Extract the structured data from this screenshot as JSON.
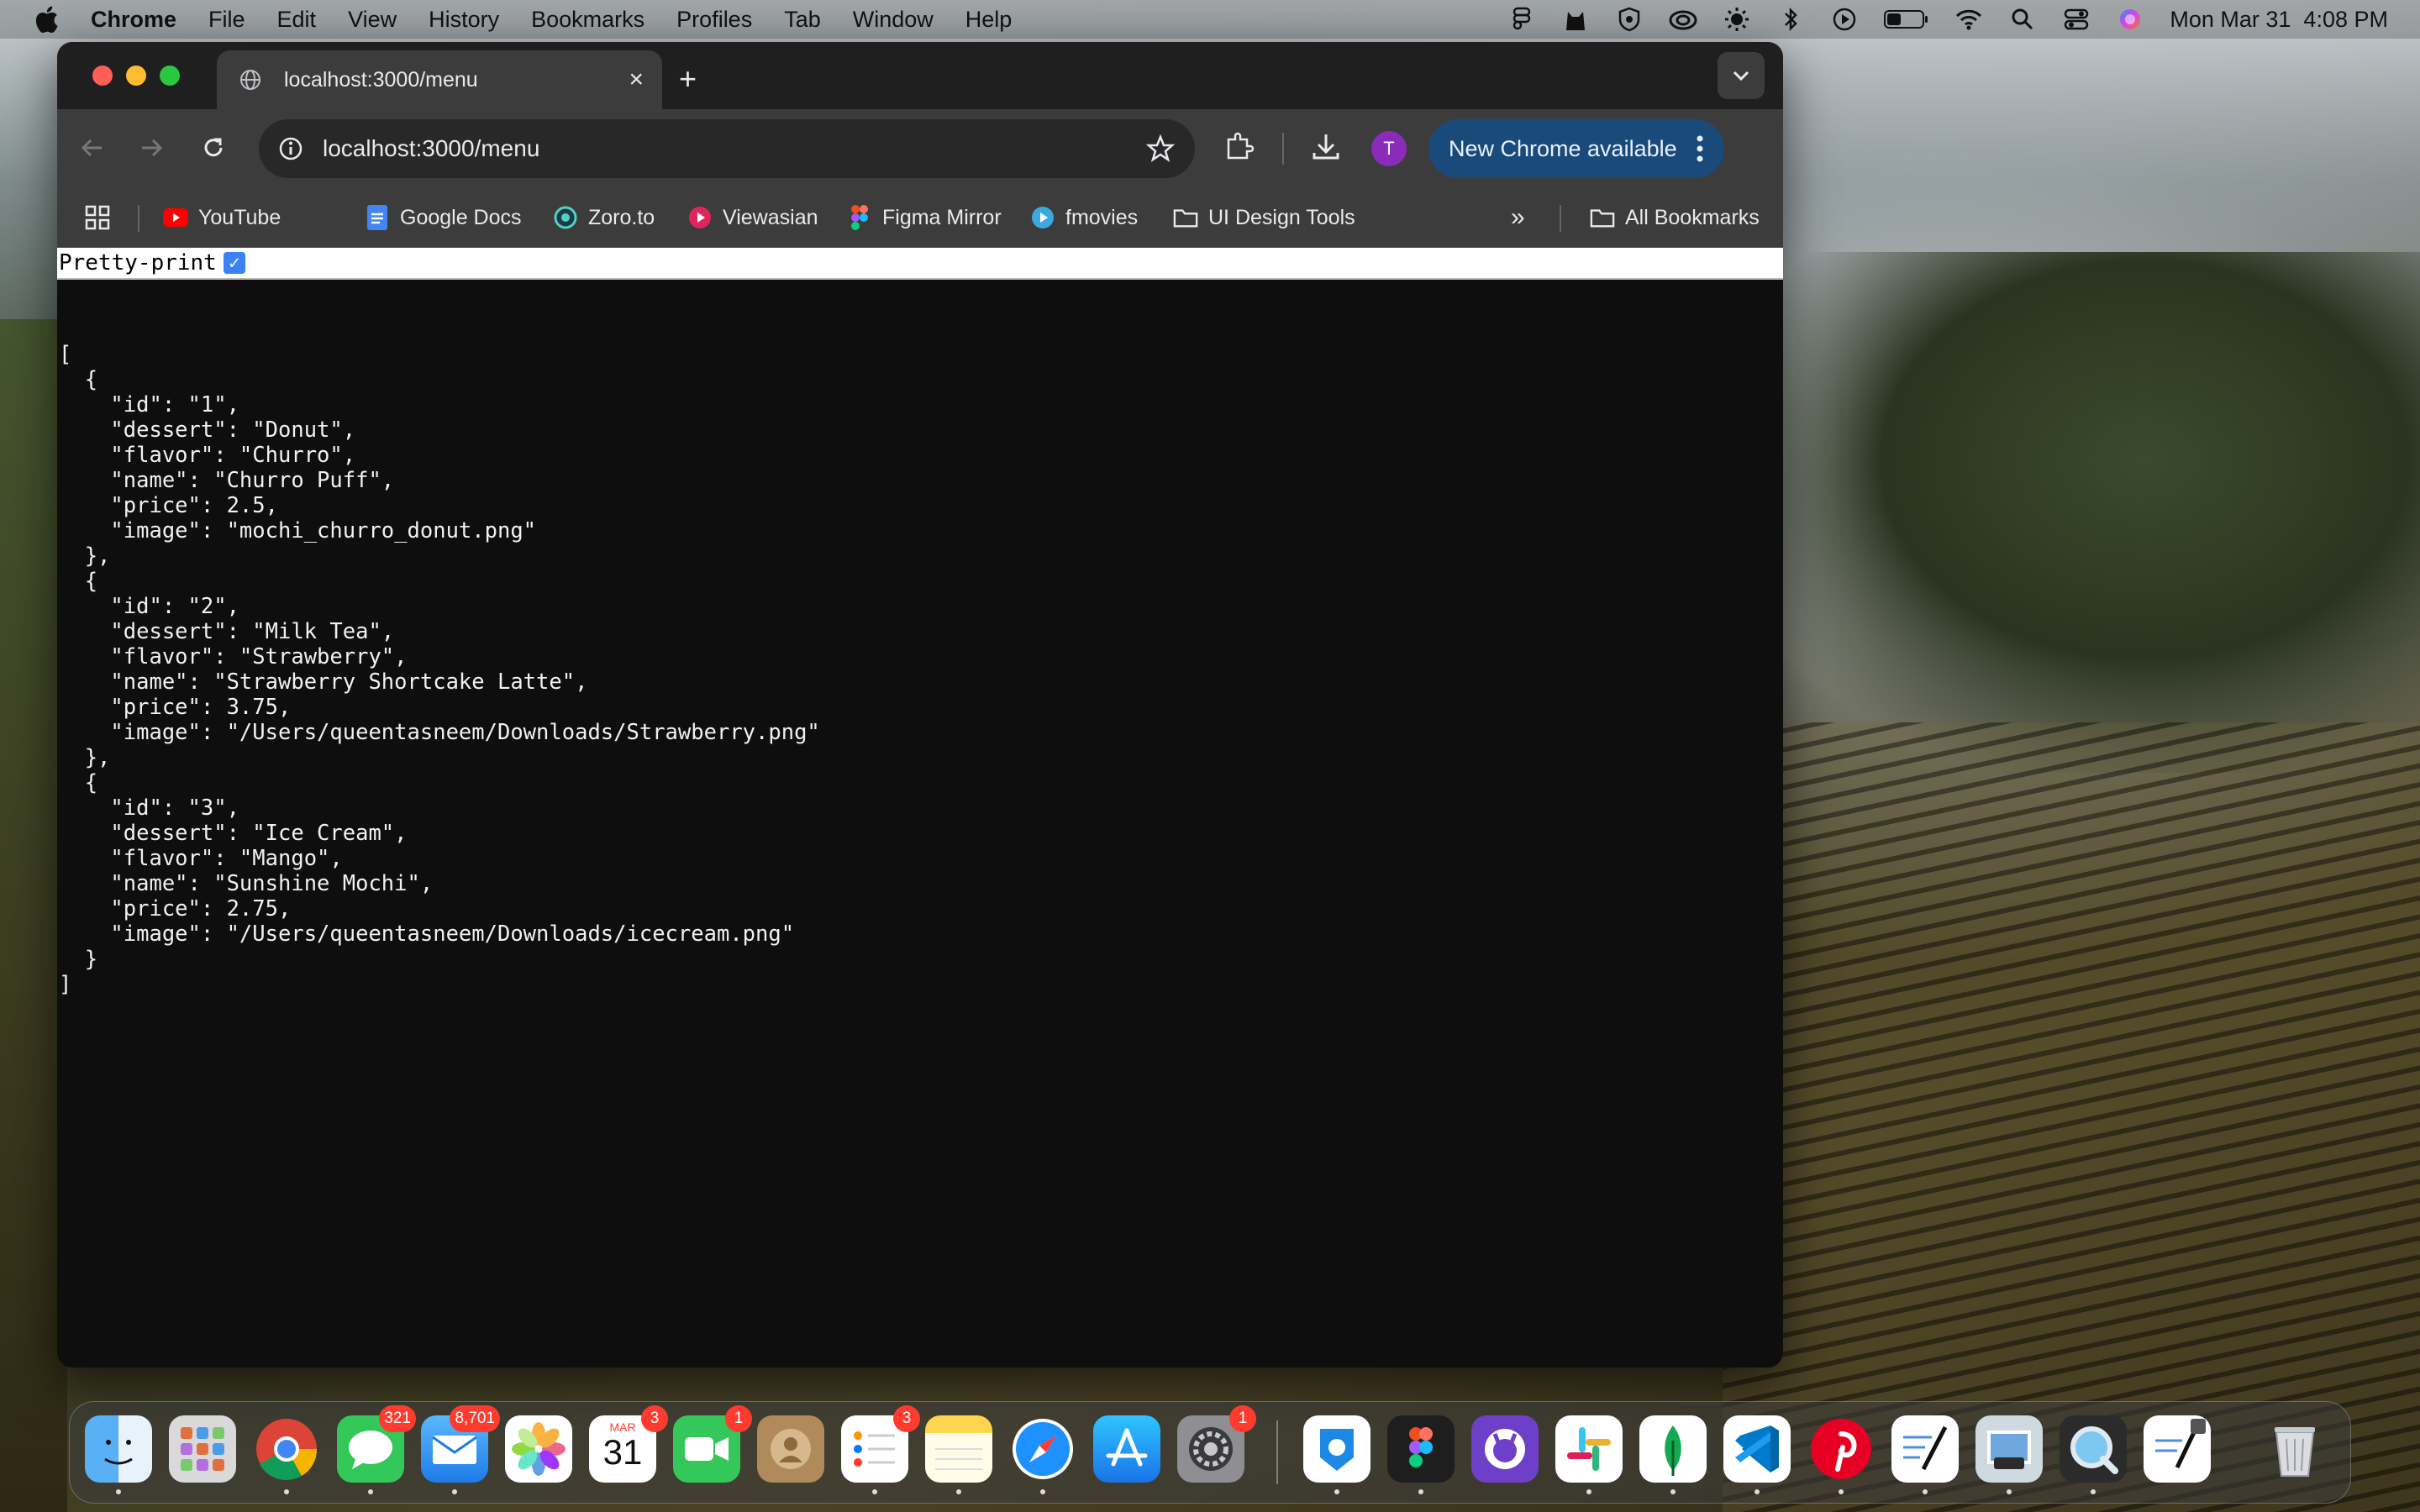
{
  "menubar": {
    "app": "Chrome",
    "items": [
      "File",
      "Edit",
      "View",
      "History",
      "Bookmarks",
      "Profiles",
      "Tab",
      "Window",
      "Help"
    ],
    "datetime": "Mon Mar 31  4:08 PM"
  },
  "tab": {
    "title": "localhost:3000/menu",
    "close": "×",
    "new_tab": "+"
  },
  "toolbar": {
    "url": "localhost:3000/menu",
    "avatar_initial": "T",
    "update_label": "New Chrome available"
  },
  "bookmarks": {
    "items": [
      "YouTube",
      "Google Docs",
      "Zoro.to",
      "Viewasian",
      "Figma Mirror",
      "fmovies",
      "UI Design Tools"
    ],
    "overflow": "»",
    "all": "All Bookmarks"
  },
  "pretty_print": {
    "label": "Pretty-print",
    "checked": "✓"
  },
  "json_text": "[\n  {\n    \"id\": \"1\",\n    \"dessert\": \"Donut\",\n    \"flavor\": \"Churro\",\n    \"name\": \"Churro Puff\",\n    \"price\": 2.5,\n    \"image\": \"mochi_churro_donut.png\"\n  },\n  {\n    \"id\": \"2\",\n    \"dessert\": \"Milk Tea\",\n    \"flavor\": \"Strawberry\",\n    \"name\": \"Strawberry Shortcake Latte\",\n    \"price\": 3.75,\n    \"image\": \"/Users/queentasneem/Downloads/Strawberry.png\"\n  },\n  {\n    \"id\": \"3\",\n    \"dessert\": \"Ice Cream\",\n    \"flavor\": \"Mango\",\n    \"name\": \"Sunshine Mochi\",\n    \"price\": 2.75,\n    \"image\": \"/Users/queentasneem/Downloads/icecream.png\"\n  }\n]",
  "dock": {
    "badges": {
      "messages": "321",
      "mail": "8,701",
      "calendar": "3",
      "facetime": "1",
      "reminders": "3",
      "settings": "1"
    },
    "calendar_month": "MAR",
    "calendar_day": "31"
  },
  "colors": {
    "close": "#ff5f57",
    "minimize": "#febc2e",
    "zoom": "#28c840",
    "update_bg": "#1a4a7a",
    "avatar": "#8a2bb9",
    "badge": "#ff3b30"
  }
}
